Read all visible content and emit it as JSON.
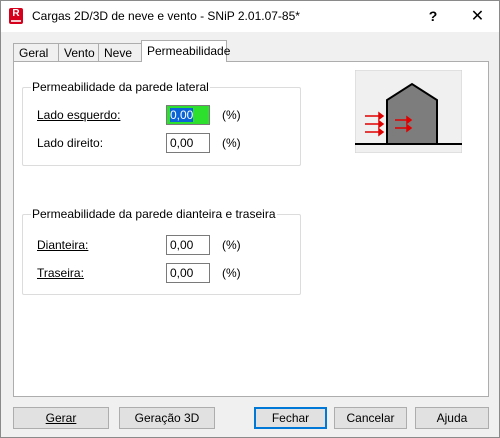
{
  "window": {
    "title": "Cargas 2D/3D de neve e vento - SNiP 2.01.07-85*",
    "app_icon_letter": "R",
    "help_glyph": "?",
    "close_glyph": "✕"
  },
  "tabs": [
    {
      "label": "Geral",
      "active": false
    },
    {
      "label": "Vento",
      "active": false
    },
    {
      "label": "Neve",
      "active": false
    },
    {
      "label": "Permeabilidade",
      "active": true
    }
  ],
  "lateral": {
    "title": "Permeabilidade da parede lateral",
    "left_label": "Lado esquerdo:",
    "left_value": "0,00",
    "right_label": "Lado direito:",
    "right_value": "0,00",
    "unit": "(%)"
  },
  "front_back": {
    "title": "Permeabilidade da parede dianteira e traseira",
    "front_label": "Dianteira:",
    "front_value": "0,00",
    "back_label": "Traseira:",
    "back_value": "0,00",
    "unit": "(%)"
  },
  "illustration": {
    "icon": "building-wind-permeability-icon",
    "arrow_color": "#e00000",
    "house_color": "#7d7d7d"
  },
  "buttons": {
    "gerar": "Gerar",
    "geracao3d": "Geração 3D",
    "fechar": "Fechar",
    "cancelar": "Cancelar",
    "ajuda": "Ajuda"
  },
  "colors": {
    "focus_field": "#2ee02e",
    "default_button_border": "#0078d7"
  }
}
